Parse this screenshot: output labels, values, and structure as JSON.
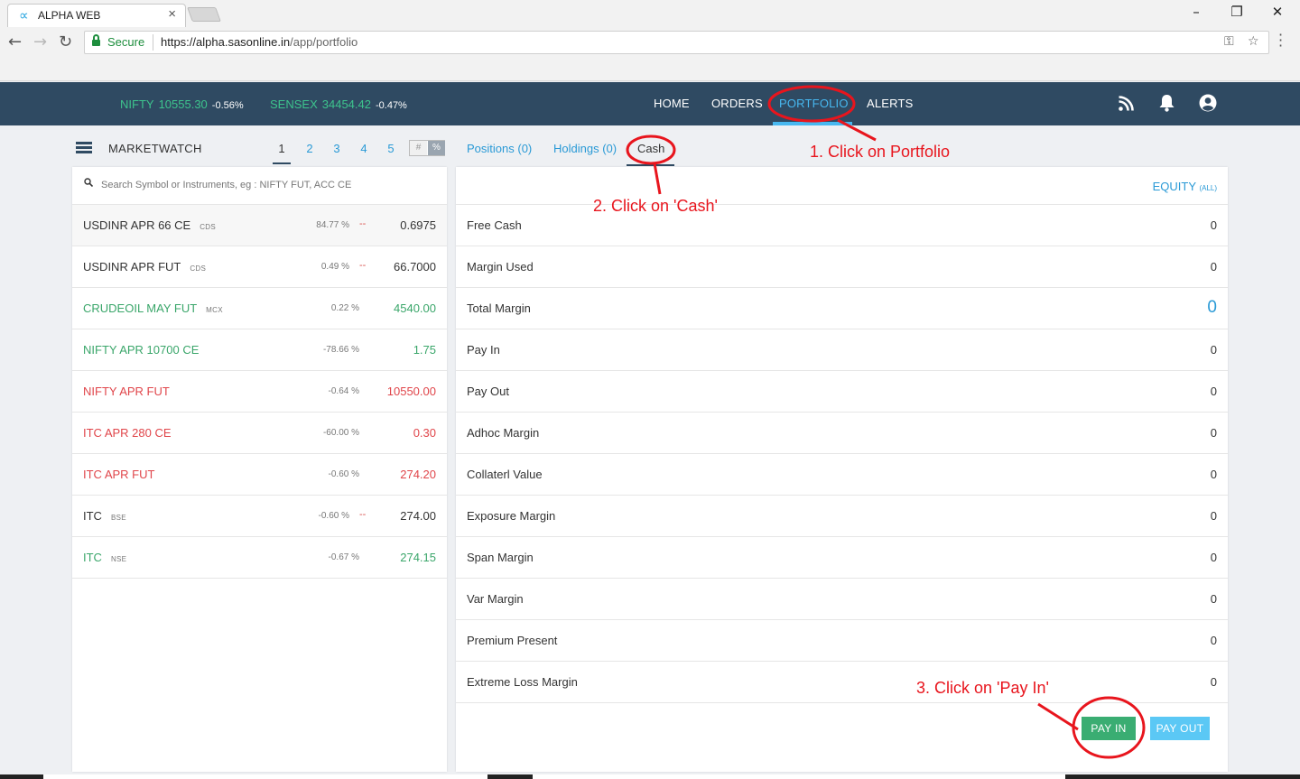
{
  "browser": {
    "tab_title": "ALPHA WEB",
    "tab_logo": "∝",
    "tab_close": "×",
    "secure_label": "Secure",
    "url_scheme_host": "https://alpha.sasonline.in",
    "url_path": "/app/portfolio",
    "icons": [
      "back-icon",
      "forward-icon",
      "reload-icon",
      "key-icon",
      "star-icon",
      "menu-icon"
    ],
    "window_controls": [
      "minimize",
      "restore",
      "close"
    ]
  },
  "ticker": {
    "nifty": {
      "name": "NIFTY",
      "value": "10555.30",
      "change": "-0.56%"
    },
    "sensex": {
      "name": "SENSEX",
      "value": "34454.42",
      "change": "-0.47%"
    }
  },
  "nav": {
    "home": "HOME",
    "orders": "ORDERS",
    "portfolio": "PORTFOLIO",
    "alerts": "ALERTS",
    "active": "PORTFOLIO",
    "icons": [
      "rss-icon",
      "bell-icon",
      "user-icon"
    ],
    "active_color": "#47b8f0"
  },
  "marketwatch": {
    "title": "MARKETWATCH",
    "pages": [
      "1",
      "2",
      "3",
      "4",
      "5"
    ],
    "active_page": "1",
    "toggle": {
      "left": "#",
      "right": "%"
    },
    "search_placeholder": "Search Symbol or Instruments, eg : NIFTY FUT, ACC CE",
    "rows": [
      {
        "symbol": "USDINR APR 66 CE",
        "exchange": "CDS",
        "change": "84.77 %",
        "dash": "--",
        "price": "0.6975",
        "color": "dark"
      },
      {
        "symbol": "USDINR APR FUT",
        "exchange": "CDS",
        "change": "0.49 %",
        "dash": "--",
        "price": "66.7000",
        "color": "dark"
      },
      {
        "symbol": "CRUDEOIL MAY FUT",
        "exchange": "MCX",
        "change": "0.22 %",
        "dash": "",
        "price": "4540.00",
        "color": "green"
      },
      {
        "symbol": "NIFTY APR 10700 CE",
        "exchange": "",
        "change": "-78.66 %",
        "dash": "",
        "price": "1.75",
        "color": "green"
      },
      {
        "symbol": "NIFTY APR FUT",
        "exchange": "",
        "change": "-0.64 %",
        "dash": "",
        "price": "10550.00",
        "color": "red"
      },
      {
        "symbol": "ITC APR 280 CE",
        "exchange": "",
        "change": "-60.00 %",
        "dash": "",
        "price": "0.30",
        "color": "red"
      },
      {
        "symbol": "ITC APR FUT",
        "exchange": "",
        "change": "-0.60 %",
        "dash": "",
        "price": "274.20",
        "color": "red"
      },
      {
        "symbol": "ITC",
        "exchange": "BSE",
        "change": "-0.60 %",
        "dash": "--",
        "price": "274.00",
        "color": "dark"
      },
      {
        "symbol": "ITC",
        "exchange": "NSE",
        "change": "-0.67 %",
        "dash": "",
        "price": "274.15",
        "color": "green"
      }
    ]
  },
  "portfolio_tabs": {
    "positions": "Positions (0)",
    "holdings": "Holdings (0)",
    "cash": "Cash",
    "active": "Cash"
  },
  "cash": {
    "segment": "EQUITY",
    "segment_sub": "(ALL)",
    "rows": [
      {
        "label": "Free Cash",
        "value": "0"
      },
      {
        "label": "Margin Used",
        "value": "0"
      },
      {
        "label": "Total Margin",
        "value": "0"
      },
      {
        "label": "Pay In",
        "value": "0"
      },
      {
        "label": "Pay Out",
        "value": "0"
      },
      {
        "label": "Adhoc Margin",
        "value": "0"
      },
      {
        "label": "Collaterl Value",
        "value": "0"
      },
      {
        "label": "Exposure Margin",
        "value": "0"
      },
      {
        "label": "Span Margin",
        "value": "0"
      },
      {
        "label": "Var Margin",
        "value": "0"
      },
      {
        "label": "Premium Present",
        "value": "0"
      },
      {
        "label": "Extreme Loss Margin",
        "value": "0"
      }
    ],
    "pay_in_label": "PAY IN",
    "pay_out_label": "PAY OUT"
  },
  "annotations": {
    "step1": "1. Click on Portfolio",
    "step2": "2. Click on 'Cash'",
    "step3": "3. Click on 'Pay In'",
    "color": "#e8151d"
  },
  "colors": {
    "navbar": "#2f4a62",
    "green": "#3aa66a",
    "red": "#e0454a",
    "link": "#2a9ad6",
    "pay_in": "#3aad72",
    "pay_out": "#5bc8f5"
  }
}
